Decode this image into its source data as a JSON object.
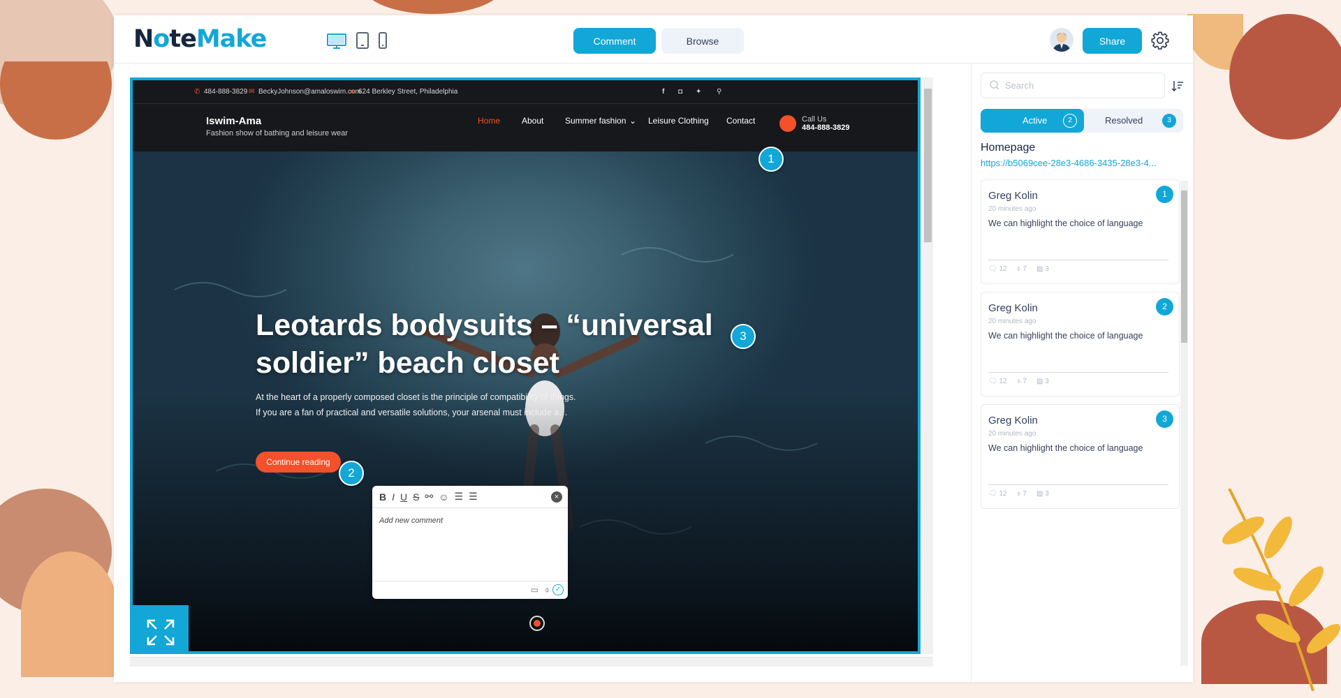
{
  "app": {
    "logo_left": "N",
    "logo_o": "o",
    "logo_mid": "te",
    "logo_right": "Make",
    "mode_active": "Comment",
    "mode_inactive": "Browse",
    "share_label": "Share"
  },
  "site": {
    "phone": "484-888-3829",
    "email": "BeckyJohnson@amaloswim.com",
    "address": "624 Berkley Street, Philadelphia",
    "brand_title": "Iswim-Ama",
    "brand_sub": "Fashion show of bathing and leisure wear",
    "nav": [
      "Home",
      "About",
      "Summer fashion",
      "Leisure Clothing",
      "Contact"
    ],
    "call_label": "Call Us",
    "call_number": "484-888-3829",
    "headline": "Leotards bodysuits – “universal soldier” beach closet",
    "lede": "At the heart of a properly composed closet is the principle of compatibility of things. If you are a fan of practical and versatile solutions, your arsenal must include a…",
    "cta": "Continue reading"
  },
  "pins": [
    "1",
    "2",
    "3"
  ],
  "editor": {
    "placeholder": "Add new comment"
  },
  "panel": {
    "search_placeholder": "Search",
    "tab_active": "Active",
    "tab_active_count": "2",
    "tab_resolved": "Resolved",
    "tab_resolved_count": "3",
    "page_name": "Homepage",
    "page_url": "https://b5069cee-28e3-4686-3435-28e3-4...",
    "comments": [
      {
        "author": "Greg Kolin",
        "time": "20 minutes ago",
        "text": "We can highlight the choice of language",
        "replies": "12",
        "attachments": "7",
        "images": "3",
        "number": "1"
      },
      {
        "author": "Greg Kolin",
        "time": "20 minutes ago",
        "text": "We can highlight the choice of language",
        "replies": "12",
        "attachments": "7",
        "images": "3",
        "number": "2"
      },
      {
        "author": "Greg Kolin",
        "time": "20 minutes ago",
        "text": "We can highlight the choice of language",
        "replies": "12",
        "attachments": "7",
        "images": "3",
        "number": "3"
      }
    ]
  },
  "colors": {
    "accent": "#12a7d6",
    "site_accent": "#f2512c",
    "dark_text": "#17253d"
  }
}
